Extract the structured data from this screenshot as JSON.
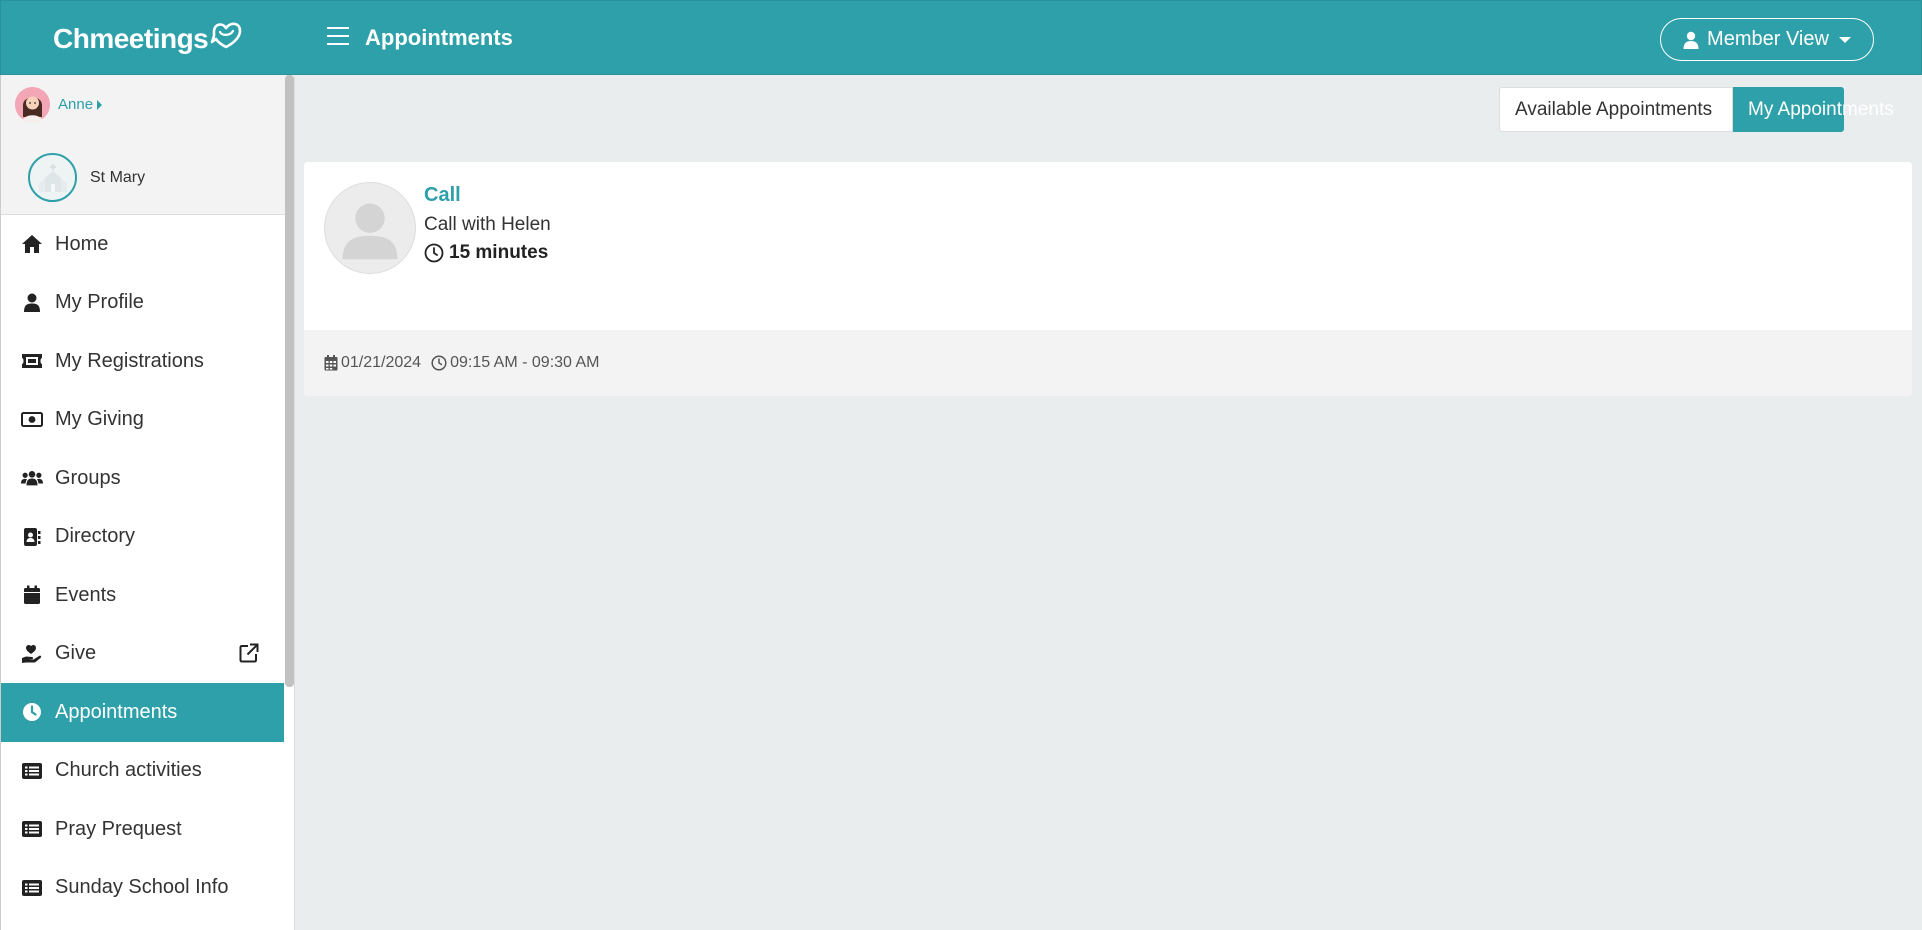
{
  "header": {
    "logo_text": "Chmeetings",
    "page_title": "Appointments",
    "member_view_label": "Member View"
  },
  "sidebar": {
    "user_name": "Anne",
    "church_name": "St Mary",
    "items": [
      {
        "label": "Home",
        "icon": "home-icon"
      },
      {
        "label": "My Profile",
        "icon": "user-icon"
      },
      {
        "label": "My Registrations",
        "icon": "ticket-icon"
      },
      {
        "label": "My Giving",
        "icon": "money-icon"
      },
      {
        "label": "Groups",
        "icon": "users-icon"
      },
      {
        "label": "Directory",
        "icon": "address-book-icon"
      },
      {
        "label": "Events",
        "icon": "calendar-icon"
      },
      {
        "label": "Give",
        "icon": "hand-heart-icon"
      },
      {
        "label": "Appointments",
        "icon": "clock-icon"
      },
      {
        "label": "Church activities",
        "icon": "list-icon"
      },
      {
        "label": "Pray Prequest",
        "icon": "list-icon"
      },
      {
        "label": "Sunday School Info",
        "icon": "list-icon"
      }
    ],
    "active_item": "Appointments"
  },
  "tabs": {
    "available_label": "Available Appointments",
    "mine_label": "My Appointments",
    "selected": "My Appointments"
  },
  "appointment": {
    "title": "Call",
    "description": "Call with Helen",
    "duration": "15 minutes",
    "date": "01/21/2024",
    "time_range": "09:15 AM - 09:30 AM"
  },
  "colors": {
    "brand": "#2ea0a9",
    "background": "#eaeded"
  }
}
